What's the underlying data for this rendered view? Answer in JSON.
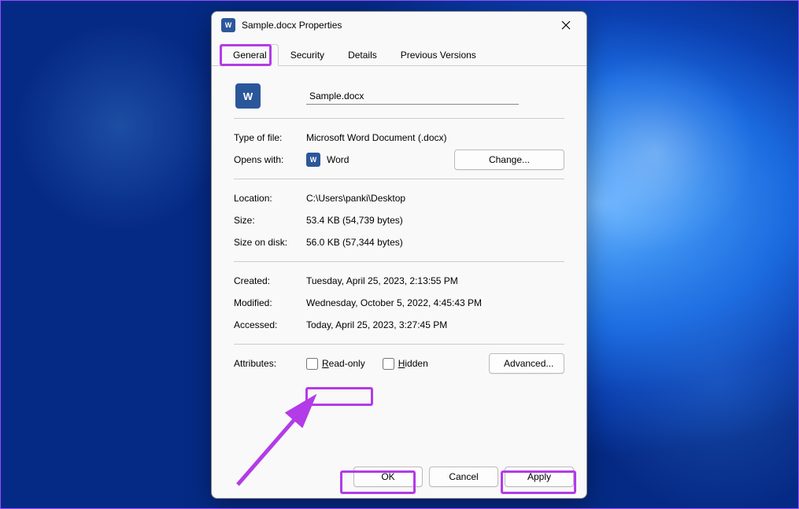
{
  "window": {
    "title": "Sample.docx Properties"
  },
  "tabs": {
    "general": "General",
    "security": "Security",
    "details": "Details",
    "previous": "Previous Versions"
  },
  "filename": "Sample.docx",
  "rows": {
    "type_label": "Type of file:",
    "type_value": "Microsoft Word Document (.docx)",
    "opens_label": "Opens with:",
    "opens_app": "Word",
    "change_btn": "Change...",
    "location_label": "Location:",
    "location_value": "C:\\Users\\panki\\Desktop",
    "size_label": "Size:",
    "size_value": "53.4 KB (54,739 bytes)",
    "disk_label": "Size on disk:",
    "disk_value": "56.0 KB (57,344 bytes)",
    "created_label": "Created:",
    "created_value": "Tuesday, April 25, 2023, 2:13:55 PM",
    "modified_label": "Modified:",
    "modified_value": "Wednesday, October 5, 2022, 4:45:43 PM",
    "accessed_label": "Accessed:",
    "accessed_value": "Today, April 25, 2023, 3:27:45 PM",
    "attributes_label": "Attributes:",
    "readonly_label": "Read-only",
    "hidden_label": "Hidden",
    "advanced_btn": "Advanced..."
  },
  "footer": {
    "ok": "OK",
    "cancel": "Cancel",
    "apply": "Apply"
  },
  "annotation": {
    "highlight_color": "#b33be8"
  }
}
